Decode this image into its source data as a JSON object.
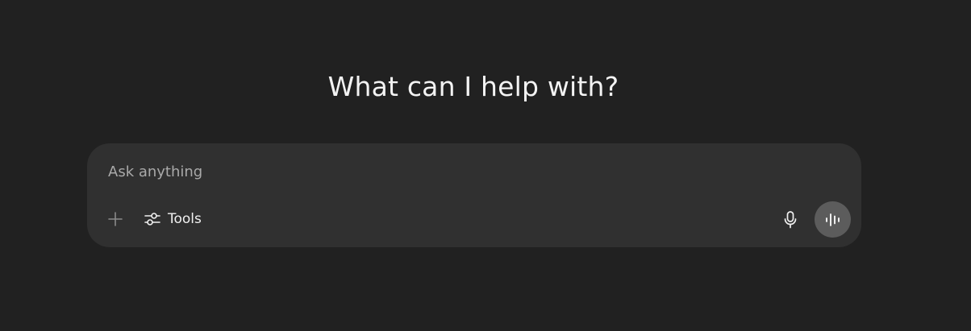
{
  "hero": {
    "title": "What can I help with?"
  },
  "composer": {
    "placeholder": "Ask anything",
    "value": "",
    "tools_label": "Tools"
  },
  "icons": {
    "plus": "plus-icon",
    "tools": "sliders-icon",
    "mic": "microphone-icon",
    "voice": "voice-waveform-icon"
  },
  "colors": {
    "background": "#212121",
    "composer": "#303030",
    "voice_button": "#5c5c5c",
    "text": "#ececec",
    "placeholder": "#a9a9a9"
  }
}
